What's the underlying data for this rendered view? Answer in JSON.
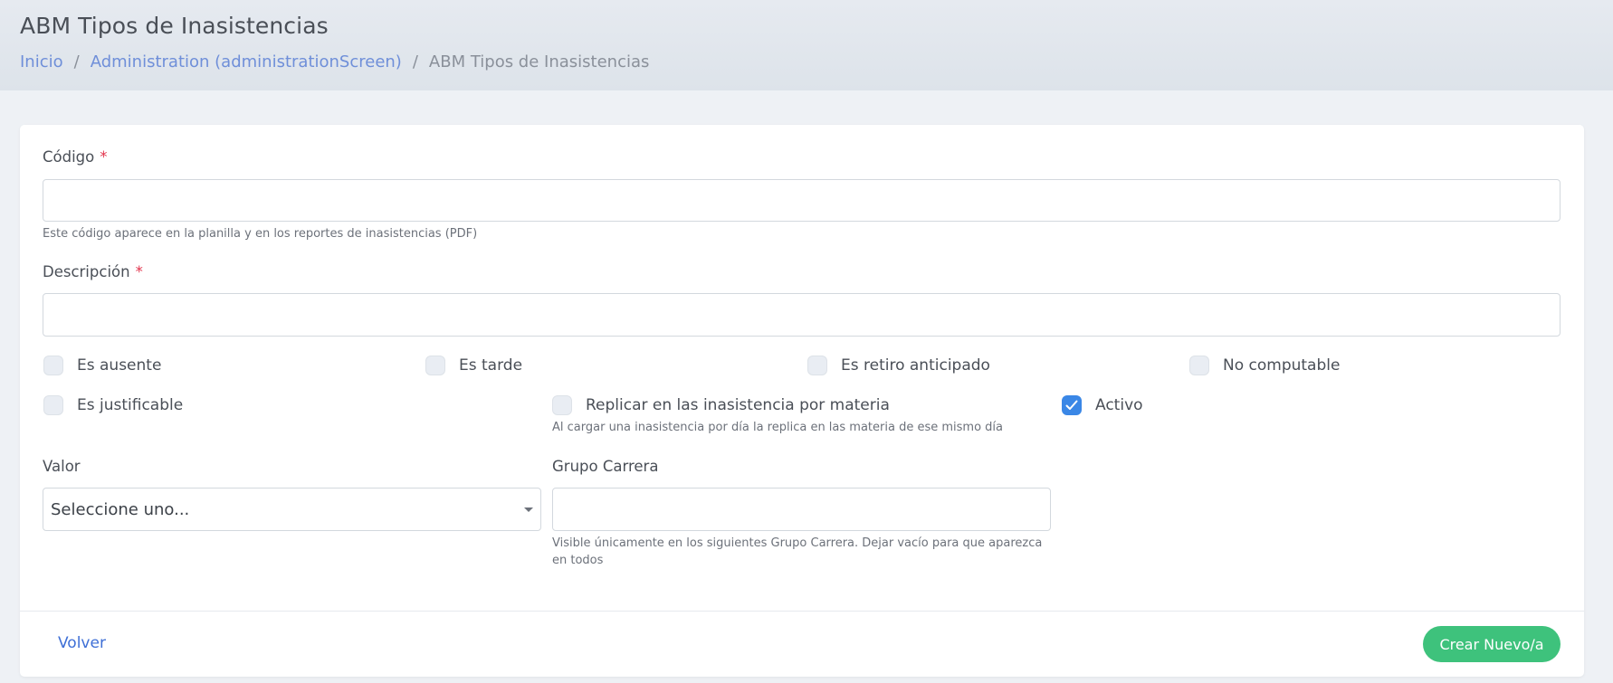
{
  "header": {
    "title": "ABM Tipos de Inasistencias",
    "breadcrumb": {
      "home": "Inicio",
      "parent": "Administration (administrationScreen)",
      "current": "ABM Tipos de Inasistencias",
      "separator": "/"
    }
  },
  "form": {
    "codigo": {
      "label": "Código",
      "required_mark": "*",
      "value": "",
      "help": "Este código aparece en la planilla y en los reportes de inasistencias (PDF)"
    },
    "descripcion": {
      "label": "Descripción",
      "required_mark": "*",
      "value": ""
    },
    "checkboxes": {
      "es_ausente": {
        "label": "Es ausente",
        "checked": false
      },
      "es_tarde": {
        "label": "Es tarde",
        "checked": false
      },
      "es_retiro_anticipado": {
        "label": "Es retiro anticipado",
        "checked": false
      },
      "no_computable": {
        "label": "No computable",
        "checked": false
      },
      "es_justificable": {
        "label": "Es justificable",
        "checked": false
      },
      "replicar": {
        "label": "Replicar en las inasistencia por materia",
        "checked": false,
        "help": "Al cargar una inasistencia por día la replica en las materia de ese mismo día"
      },
      "activo": {
        "label": "Activo",
        "checked": true
      }
    },
    "valor": {
      "label": "Valor",
      "selected": "Seleccione uno..."
    },
    "grupo_carrera": {
      "label": "Grupo Carrera",
      "value": "",
      "help_line1": "Visible únicamente en los siguientes Grupo Carrera. Dejar vacío para que aparezca",
      "help_line2": "en todos"
    }
  },
  "footer": {
    "back_label": "Volver",
    "create_label": "Crear Nuevo/a"
  },
  "colors": {
    "accent_link": "#3e6fd6",
    "create_button": "#3ec27c",
    "checkbox_checked": "#3a87e6",
    "required": "#e2334c"
  }
}
